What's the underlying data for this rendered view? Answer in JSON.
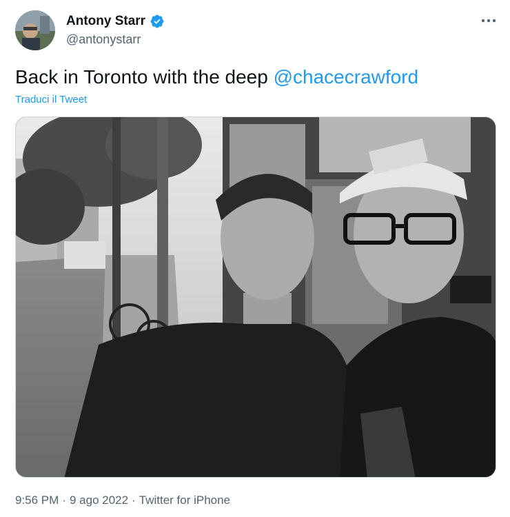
{
  "author": {
    "display_name": "Antony Starr",
    "handle": "@antonystarr",
    "verified": true,
    "avatar_icon": "profile-photo",
    "verified_icon": "verified-badge-icon"
  },
  "tweet": {
    "text_prefix": "Back in Toronto with the deep ",
    "mention": "@chacecrawford",
    "translate_label": "Traduci il Tweet",
    "media_icon": "photo"
  },
  "meta": {
    "time": "9:56 PM",
    "separator": "·",
    "date": "9 ago 2022",
    "source": "Twitter for iPhone"
  },
  "menu": {
    "icon": "more-horizontal-icon"
  },
  "colors": {
    "accent": "#1d9bf0",
    "text": "#0f1419",
    "secondary": "#536471"
  }
}
